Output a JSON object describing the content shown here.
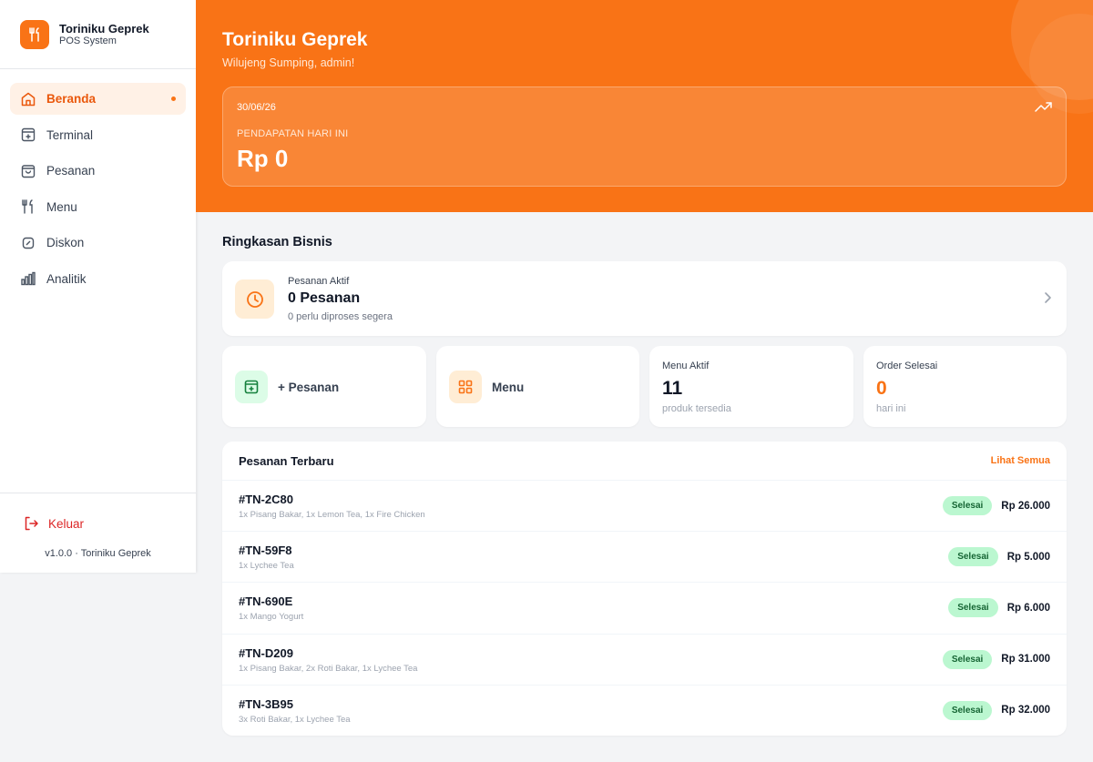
{
  "brand": {
    "name": "Toriniku Geprek",
    "subtitle": "POS System",
    "logo_icon": "utensils-icon"
  },
  "nav": {
    "items": [
      {
        "label": "Beranda",
        "icon": "home-icon",
        "active": true
      },
      {
        "label": "Terminal",
        "icon": "terminal-icon"
      },
      {
        "label": "Pesanan",
        "icon": "shopping-bag-icon"
      },
      {
        "label": "Menu",
        "icon": "utensils-icon"
      },
      {
        "label": "Diskon",
        "icon": "discount-icon"
      },
      {
        "label": "Analitik",
        "icon": "bar-chart-icon"
      }
    ],
    "logout": "Keluar",
    "version": "v1.0.0 · Toriniku Geprek"
  },
  "hero": {
    "title": "Toriniku Geprek",
    "greeting": "Wilujeng Sumping, admin!",
    "revenue": {
      "date": "30/06/26",
      "label": "PENDAPATAN HARI INI",
      "amount": "Rp 0"
    }
  },
  "summary": {
    "title": "Ringkasan Bisnis",
    "active_orders": {
      "label": "Pesanan Aktif",
      "value": "0 Pesanan",
      "sub": "0 perlu diproses segera"
    },
    "new_order_label": "+ Pesanan",
    "menu_label": "Menu",
    "menu_active": {
      "label": "Menu Aktif",
      "value": "11",
      "sub": "produk tersedia"
    },
    "orders_done": {
      "label": "Order Selesai",
      "value": "0",
      "sub": "hari ini"
    }
  },
  "recent": {
    "title": "Pesanan Terbaru",
    "see_all": "Lihat Semua",
    "orders": [
      {
        "id": "#TN-2C80",
        "items": "1x Pisang Bakar, 1x Lemon Tea, 1x Fire Chicken",
        "status": "Selesai",
        "total": "Rp 26.000"
      },
      {
        "id": "#TN-59F8",
        "items": "1x Lychee Tea",
        "status": "Selesai",
        "total": "Rp 5.000"
      },
      {
        "id": "#TN-690E",
        "items": "1x Mango Yogurt",
        "status": "Selesai",
        "total": "Rp 6.000"
      },
      {
        "id": "#TN-D209",
        "items": "1x Pisang Bakar, 2x Roti Bakar, 1x Lychee Tea",
        "status": "Selesai",
        "total": "Rp 31.000"
      },
      {
        "id": "#TN-3B95",
        "items": "3x Roti Bakar, 1x Lychee Tea",
        "status": "Selesai",
        "total": "Rp 32.000"
      }
    ]
  },
  "colors": {
    "accent": "#f97316",
    "accent_light": "#ffedd5",
    "success_bg": "#bbf7d0",
    "danger": "#dc2626"
  }
}
